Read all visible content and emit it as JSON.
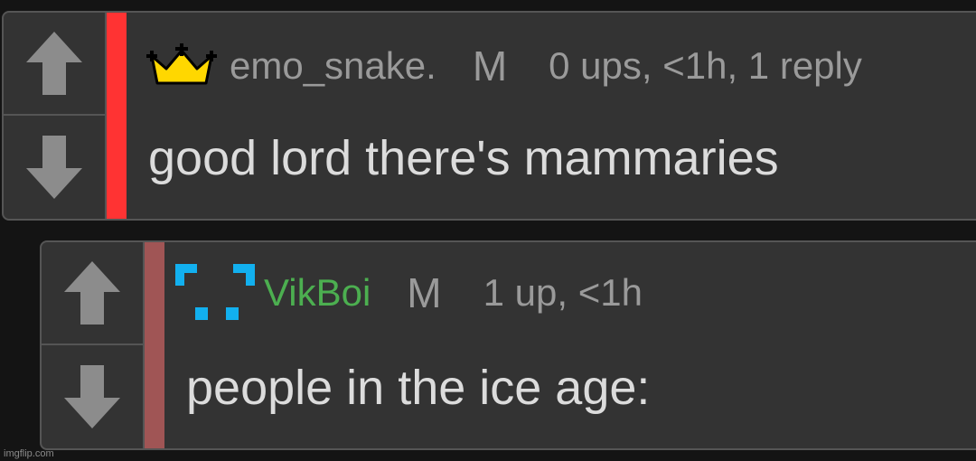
{
  "colors": {
    "background": "#141414",
    "panel": "#333333",
    "border": "#555555",
    "stripe_comment1": "#ff3333",
    "stripe_comment2": "#a05555",
    "username_default": "#9a9a9a",
    "username_green": "#4caf50",
    "crown": "#ffd700",
    "pixel_icon": "#12b0ef"
  },
  "comments": [
    {
      "icon": "crown-icon",
      "username": "emo_snake.",
      "mod_tag": "M",
      "meta": "0 ups, <1h, 1 reply",
      "text": "good lord there's mammaries"
    },
    {
      "icon": "pixel-face-icon",
      "username": "VikBoi",
      "mod_tag": "M",
      "meta": "1 up, <1h",
      "text": "people in the ice age:"
    }
  ],
  "watermark": "imgflip.com"
}
